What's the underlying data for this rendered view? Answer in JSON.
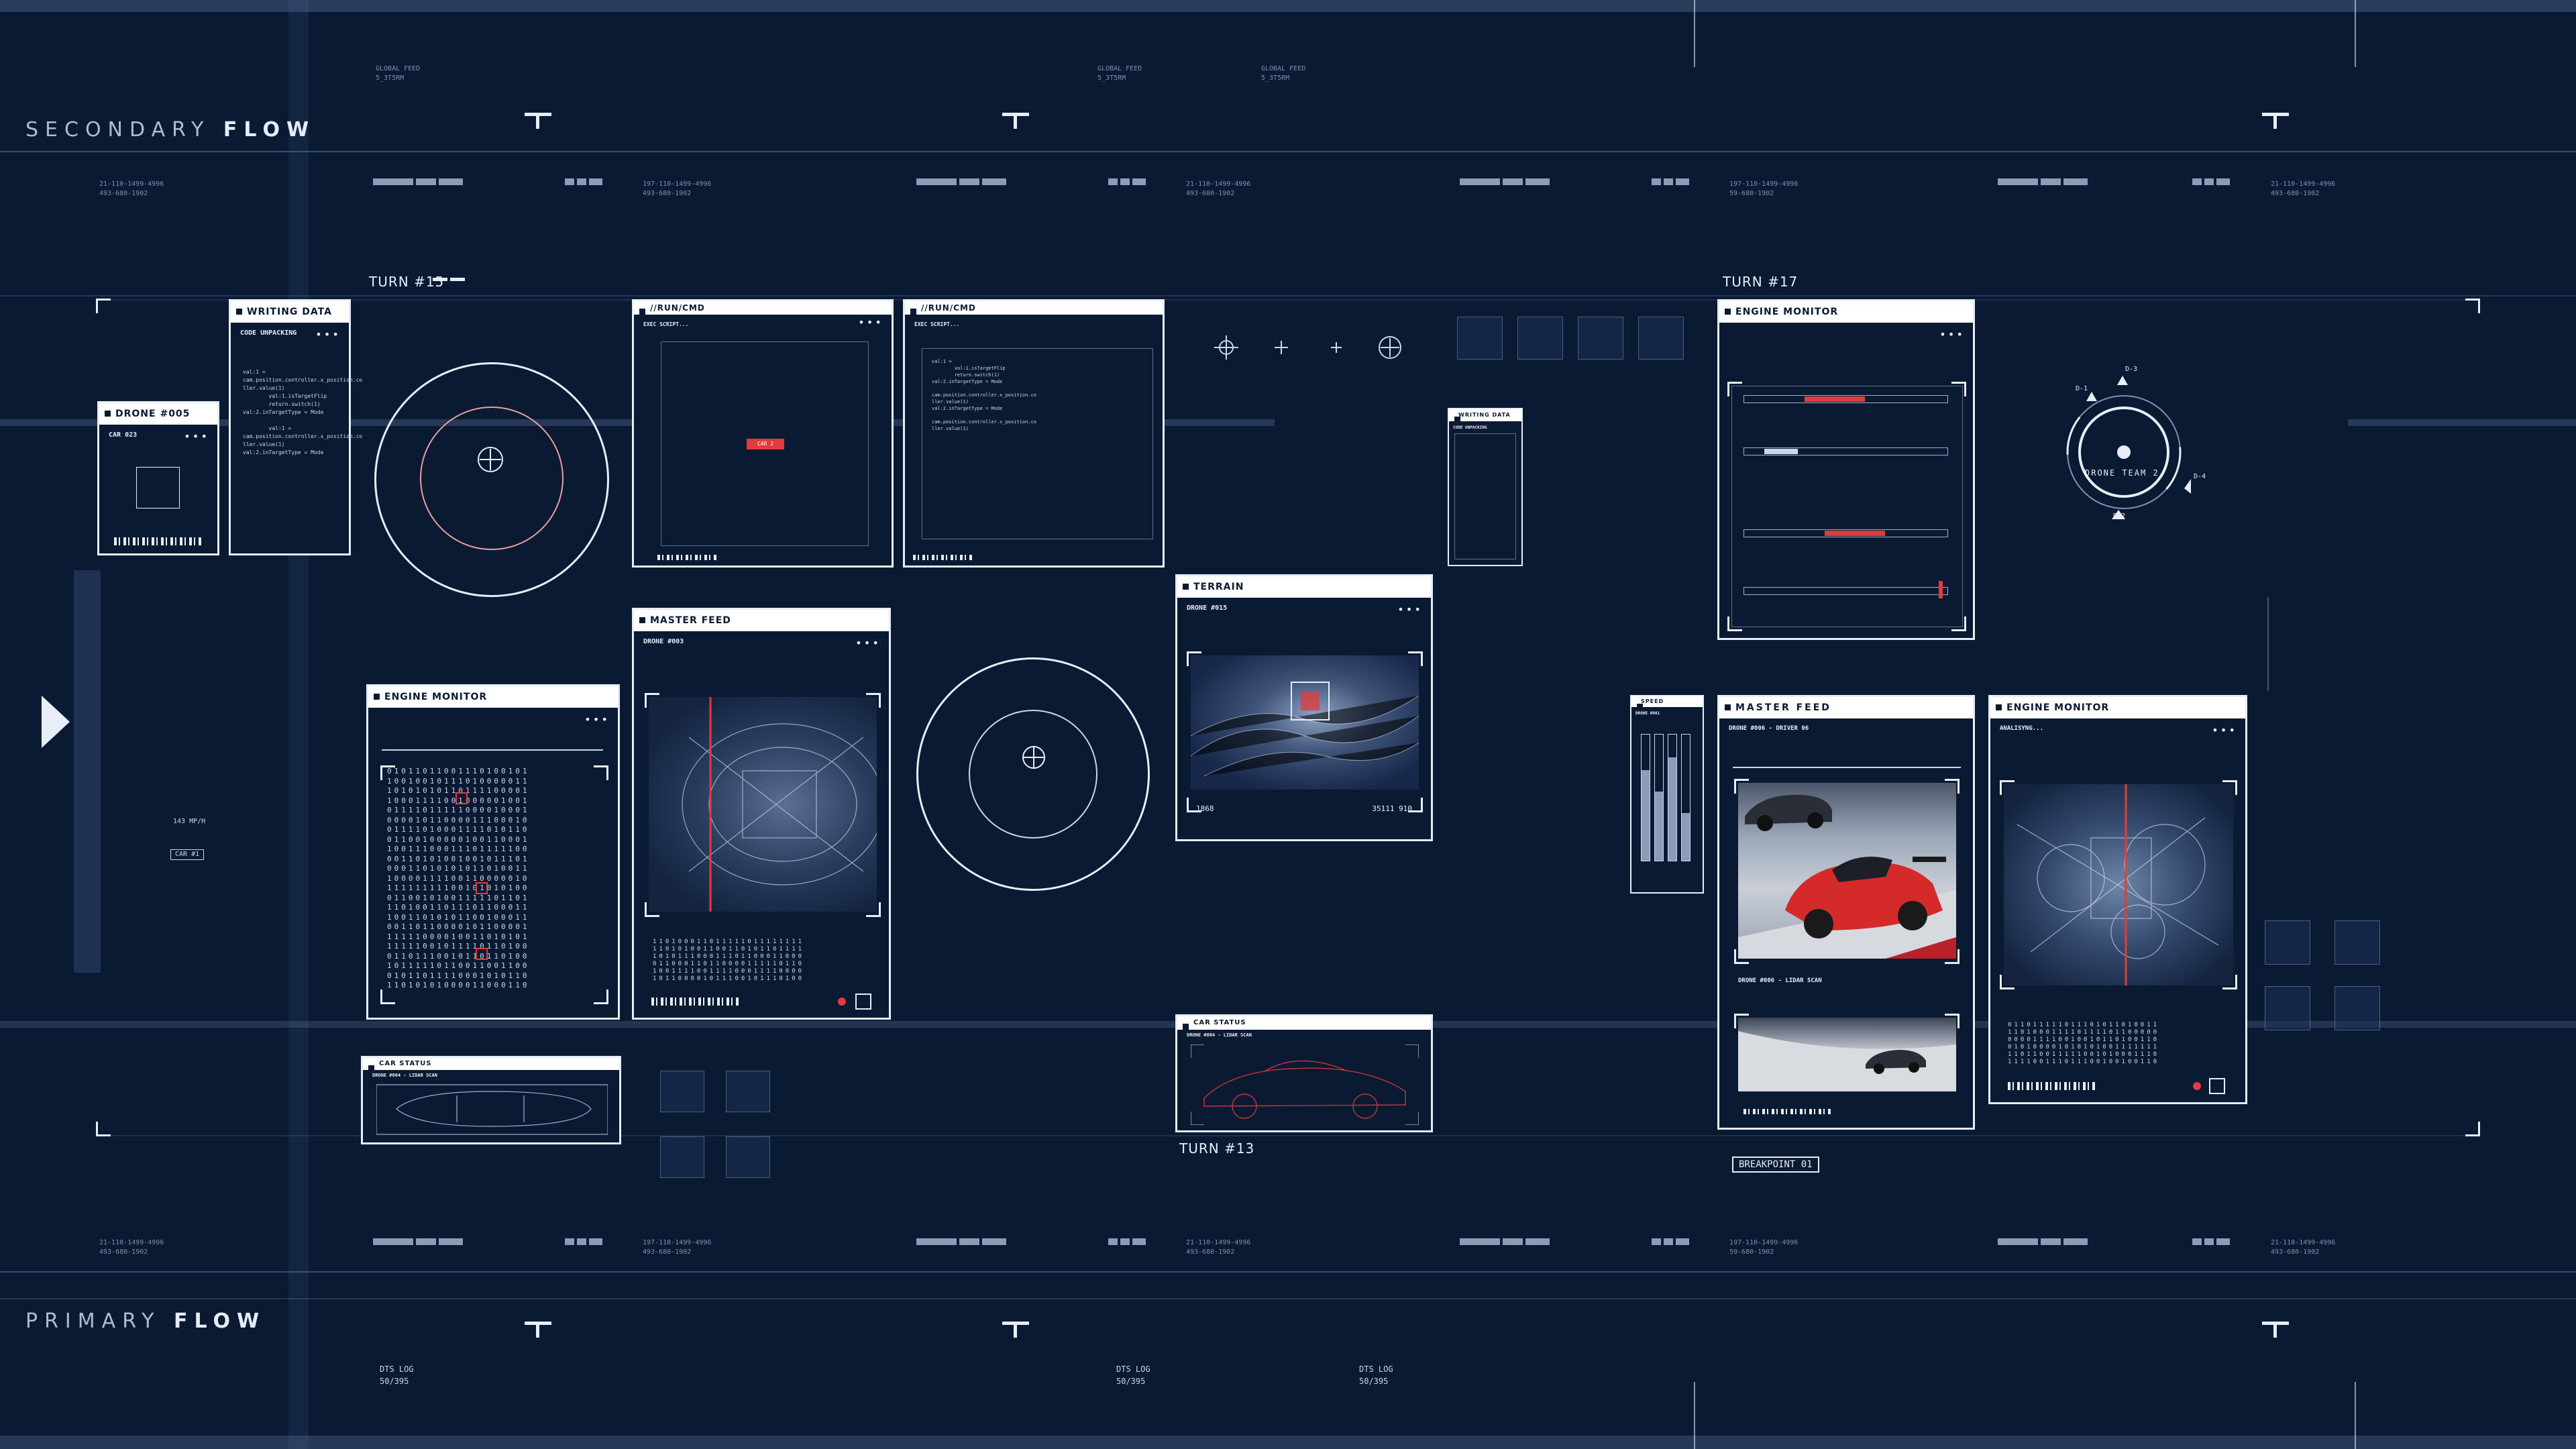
{
  "flows": {
    "secondary": {
      "light": "SECONDARY",
      "bold": "FLOW"
    },
    "primary": {
      "light": "PRIMARY",
      "bold": "FLOW"
    }
  },
  "global_feed": [
    "GLOBAL FEED\n5_3T5RM",
    "GLOBAL FEED\n5_3T5RM",
    "GLOBAL FEED\n5_3T5RM"
  ],
  "dts_logs": [
    "DTS LOG\n50/395",
    "DTS LOG\n50/395",
    "DTS LOG\n50/395"
  ],
  "id_codes": [
    "21-110-1499-4996\n493-680-1902",
    "197-110-1499-4996\n493-680-1902",
    "21-110-1499-4996\n493-680-1902",
    "197-110-1499-4996\n59-680-1902",
    "21-110-1499-4996\n493-680-1902"
  ],
  "turns": {
    "t15": "TURN #15",
    "t17": "TURN #17",
    "t13": "TURN #13"
  },
  "left_misc": {
    "speed": "143 MP/H",
    "car": "CAR #1"
  },
  "panels": {
    "drone005": {
      "title": "DRONE #005",
      "sub": "CAR 023"
    },
    "writing_data": {
      "title": "WRITING DATA",
      "sub": "CODE UNPACKING"
    },
    "run_cmd_1": {
      "title": "//RUN/CMD",
      "sub": "EXEC SCRIPT...",
      "alert": "CAR 2"
    },
    "run_cmd_2": {
      "title": "//RUN/CMD",
      "sub": "EXEC SCRIPT..."
    },
    "engine_monitor_left": {
      "title": "ENGINE MONITOR"
    },
    "master_feed_left": {
      "title": "MASTER FEED",
      "sub": "DRONE #003"
    },
    "car_status_left": {
      "title": "CAR STATUS",
      "sub": "DRONE #004 - LIDAR SCAN"
    },
    "terrain": {
      "title": "TERRAIN",
      "sub": "DRONE #015",
      "left_num": "1868",
      "right_num": "35111 910"
    },
    "car_status_mid": {
      "title": "CAR STATUS",
      "sub": "DRONE #004 - LIDAR SCAN"
    },
    "writing_data_small": {
      "title": "WRITING DATA",
      "sub": "CODE UNPACKING"
    },
    "engine_monitor_right": {
      "title": "ENGINE MONITOR"
    },
    "speed": {
      "title": "SPEED",
      "sub": "DRONE #001",
      "levels": [
        0.72,
        0.55,
        0.82,
        0.38
      ]
    },
    "master_feed_right": {
      "title": "MASTER FEED",
      "sub": "DRONE #006 - DRIVER 06",
      "caption": "DRONE #006 - LIDAR SCAN"
    },
    "engine_monitor_far": {
      "title": "ENGINE MONITOR",
      "sub": "ANALISYNG..."
    }
  },
  "drone_team": {
    "label": "DRONE TEAM 2",
    "d1": "D-1",
    "d2": "D-2",
    "d3": "D-3",
    "d4": "D-4"
  },
  "breakpoint": "BREAKPOINT 01",
  "code_lines": [
    "val:1 =",
    "cam.position.controller.x_position.co",
    "ller.value(1)",
    "        val:1.isTargetFlip",
    "        return.switch(1)",
    "val:2.inTargetType = Mode",
    "        val:1 =",
    "cam.position.controller.x_position.co",
    "ller.value(1)",
    "val:2.inTargetType = Mode"
  ],
  "colors": {
    "bg": "#0b1a33",
    "accent": "#e23b3b",
    "ink": "#e8eef8"
  }
}
